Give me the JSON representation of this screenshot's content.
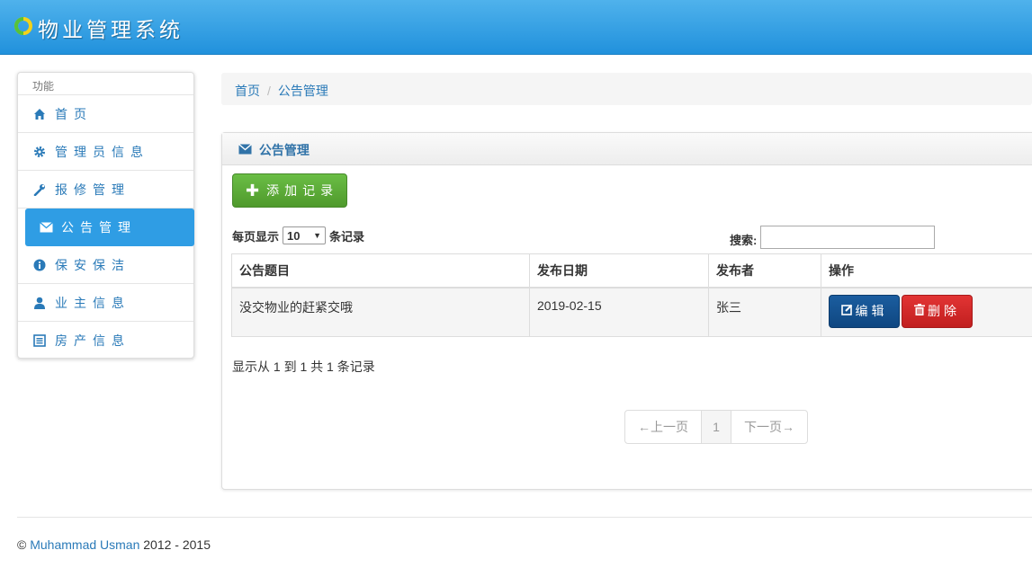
{
  "header": {
    "title": "物业管理系统",
    "logo_icon": "ring-logo-icon"
  },
  "sidebar": {
    "heading": "功能",
    "items": [
      {
        "label": "首页",
        "icon": "home-icon"
      },
      {
        "label": "管理员信息",
        "icon": "gear-icon"
      },
      {
        "label": "报修管理",
        "icon": "wrench-icon"
      },
      {
        "label": "公告管理",
        "icon": "envelope-icon",
        "active": true
      },
      {
        "label": "保安保洁",
        "icon": "info-icon"
      },
      {
        "label": "业主信息",
        "icon": "user-icon"
      },
      {
        "label": "房产信息",
        "icon": "list-icon"
      }
    ]
  },
  "breadcrumb": {
    "home": "首页",
    "separator": "/",
    "current": "公告管理"
  },
  "panel": {
    "title": "公告管理",
    "add_button": "添加记录",
    "page_size_prefix": "每页显示",
    "page_size_value": "10",
    "page_size_suffix": "条记录",
    "search_label": "搜索:",
    "search_value": ""
  },
  "table": {
    "columns": [
      "公告题目",
      "发布日期",
      "发布者",
      "操作"
    ],
    "rows": [
      {
        "title": "没交物业的赶紧交哦",
        "date": "2019-02-15",
        "author": "张三",
        "edit": "编辑",
        "delete": "删除"
      }
    ]
  },
  "summary": "显示从 1 到 1 共 1 条记录",
  "pagination": {
    "prev": "←上一页",
    "page": "1",
    "next": "下一页→"
  },
  "footer": {
    "copyright": "©",
    "author": "Muhammad Usman",
    "years": "2012 - 2015"
  },
  "colors": {
    "header": "#2f9de4",
    "active_nav": "#2f9de4",
    "add_button": "#5cae38",
    "edit_button": "#144f8c",
    "delete_button": "#d62a2a",
    "link": "#2a7ab8"
  }
}
